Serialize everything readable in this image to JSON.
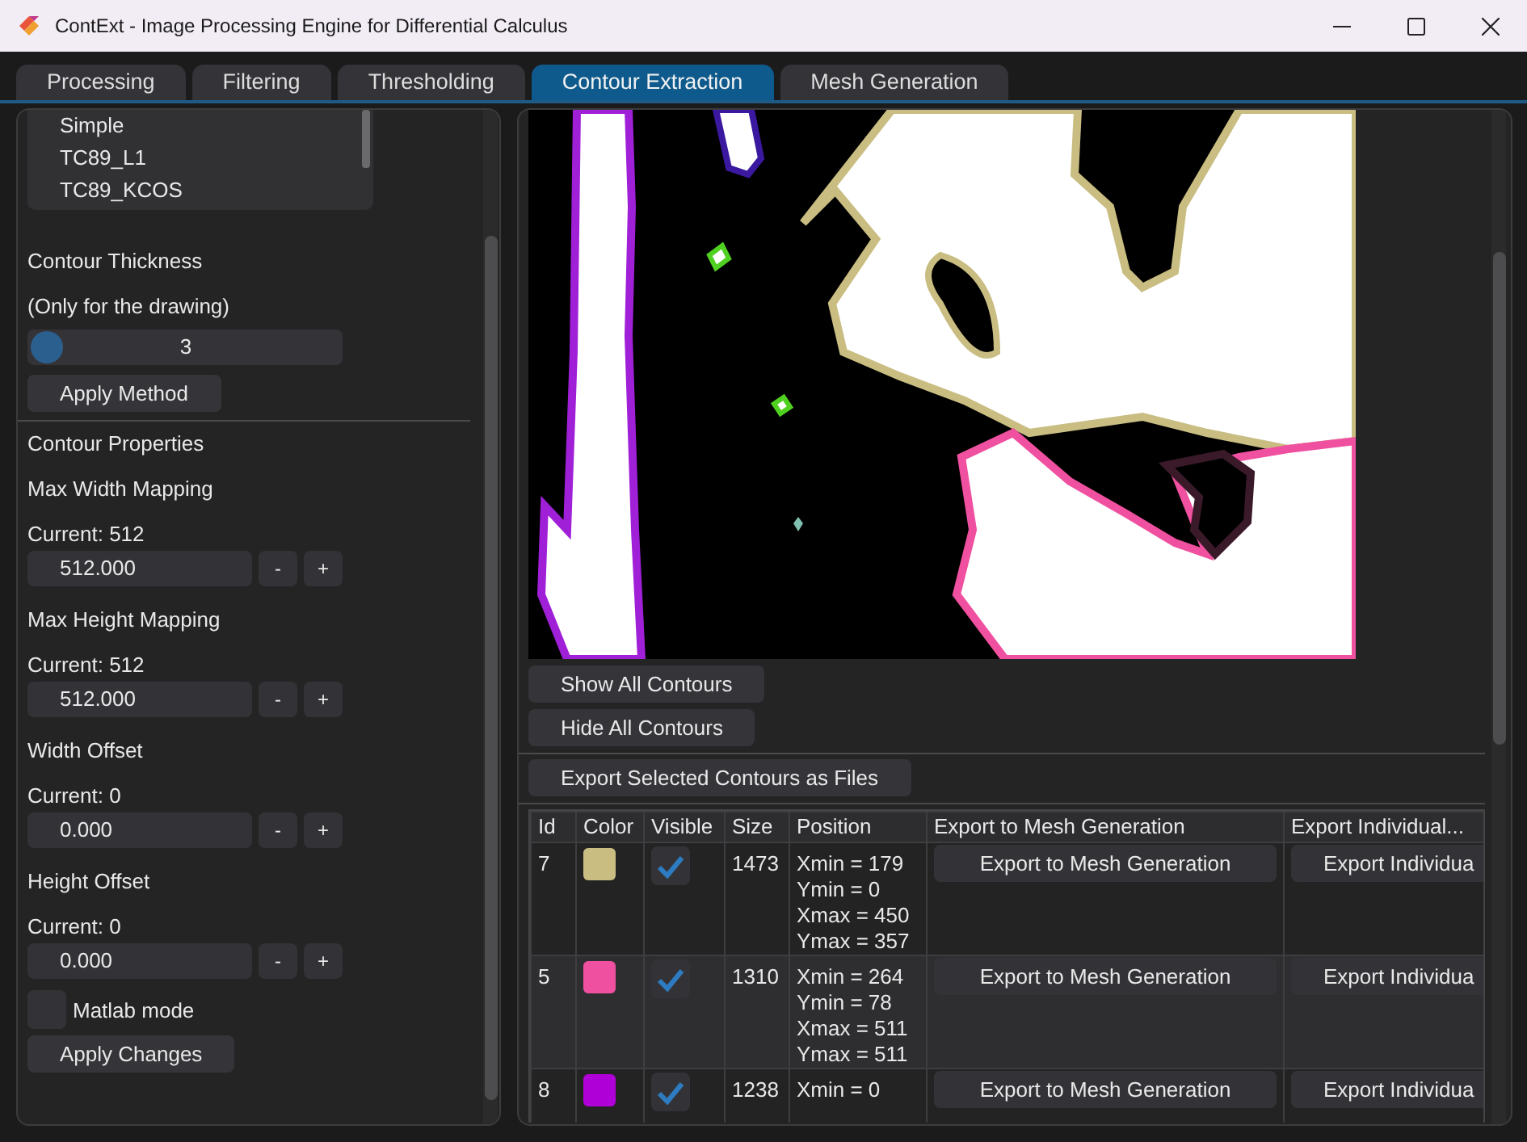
{
  "window": {
    "title": "ContExt - Image Processing Engine for Differential Calculus"
  },
  "tabs": [
    {
      "label": "Processing",
      "selected": false
    },
    {
      "label": "Filtering",
      "selected": false
    },
    {
      "label": "Thresholding",
      "selected": false
    },
    {
      "label": "Contour Extraction",
      "selected": true
    },
    {
      "label": "Mesh Generation",
      "selected": false
    }
  ],
  "left_panel": {
    "methods": [
      "Simple",
      "TC89_L1",
      "TC89_KCOS"
    ],
    "thickness_label": "Contour Thickness",
    "thickness_note": "(Only for the drawing)",
    "thickness_slider": {
      "value": "3",
      "level": 0
    },
    "apply_method": "Apply Method",
    "properties_heading": "Contour Properties",
    "mappings": [
      {
        "title": "Max Width Mapping",
        "current": "Current: 512",
        "value": "512.000",
        "minus": "-",
        "plus": "+"
      },
      {
        "title": "Max Height Mapping",
        "current": "Current: 512",
        "value": "512.000",
        "minus": "-",
        "plus": "+"
      },
      {
        "title": "Width Offset",
        "current": "Current: 0",
        "value": "0.000",
        "minus": "-",
        "plus": "+"
      },
      {
        "title": "Height Offset",
        "current": "Current: 0",
        "value": "0.000",
        "minus": "-",
        "plus": "+"
      }
    ],
    "matlab_mode": {
      "label": "Matlab mode",
      "checked": false
    },
    "apply_changes": "Apply Changes"
  },
  "contours": {
    "buttons": [
      "Show All Contours",
      "Hide All Contours"
    ],
    "export_button": "Export Selected Contours as Files",
    "table": {
      "columns": [
        "Id",
        "Color",
        "Visible",
        "Size",
        "Position",
        "Export to Mesh Generation",
        "Export Individual..."
      ],
      "rows": [
        {
          "id": "7",
          "color": "#c9bd82",
          "visible": true,
          "size": "1473",
          "position": [
            "Xmin = 179",
            "Ymin = 0",
            "Xmax = 450",
            "Ymax = 357"
          ],
          "export_mesh": "Export to Mesh Generation",
          "export_individual": "Export Individua"
        },
        {
          "id": "5",
          "color": "#f050a0",
          "visible": true,
          "size": "1310",
          "position": [
            "Xmin = 264",
            "Ymin = 78",
            "Xmax = 511",
            "Ymax = 511"
          ],
          "export_mesh": "Export to Mesh Generation",
          "export_individual": "Export Individua"
        },
        {
          "id": "8",
          "color": "#b000d8",
          "visible": true,
          "size": "1238",
          "position": [
            "Xmin = 0"
          ],
          "export_mesh": "Export to Mesh Generation",
          "export_individual": "Export Individua"
        }
      ]
    }
  }
}
